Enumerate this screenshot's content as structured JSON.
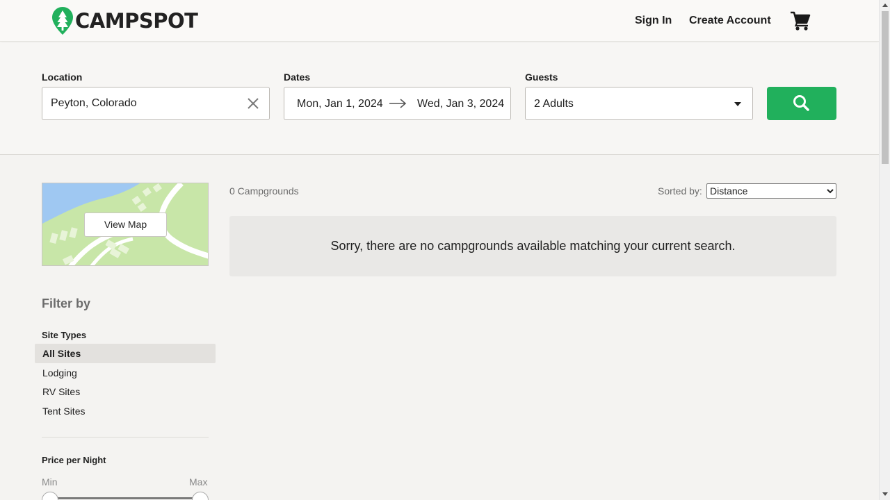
{
  "brand": {
    "name": "CAMPSPOT",
    "accent": "#21b05c"
  },
  "header": {
    "sign_in": "Sign In",
    "create_account": "Create Account",
    "cart_icon": "shopping-cart-icon"
  },
  "search": {
    "location_label": "Location",
    "location_value": "Peyton, Colorado",
    "dates_label": "Dates",
    "check_in": "Mon, Jan 1, 2024",
    "check_out": "Wed, Jan 3, 2024",
    "guests_label": "Guests",
    "guests_value": "2 Adults",
    "search_icon": "magnifier-icon"
  },
  "map": {
    "button": "View Map"
  },
  "filters": {
    "title": "Filter by",
    "site_types_title": "Site Types",
    "site_types": [
      {
        "label": "All Sites",
        "selected": true
      },
      {
        "label": "Lodging",
        "selected": false
      },
      {
        "label": "RV Sites",
        "selected": false
      },
      {
        "label": "Tent Sites",
        "selected": false
      }
    ],
    "price_title": "Price per Night",
    "price_min": "Min",
    "price_max": "Max"
  },
  "results": {
    "count": "0 Campgrounds",
    "sort_label": "Sorted by:",
    "sort_value": "Distance",
    "empty_message": "Sorry, there are no campgrounds available matching your current search."
  }
}
